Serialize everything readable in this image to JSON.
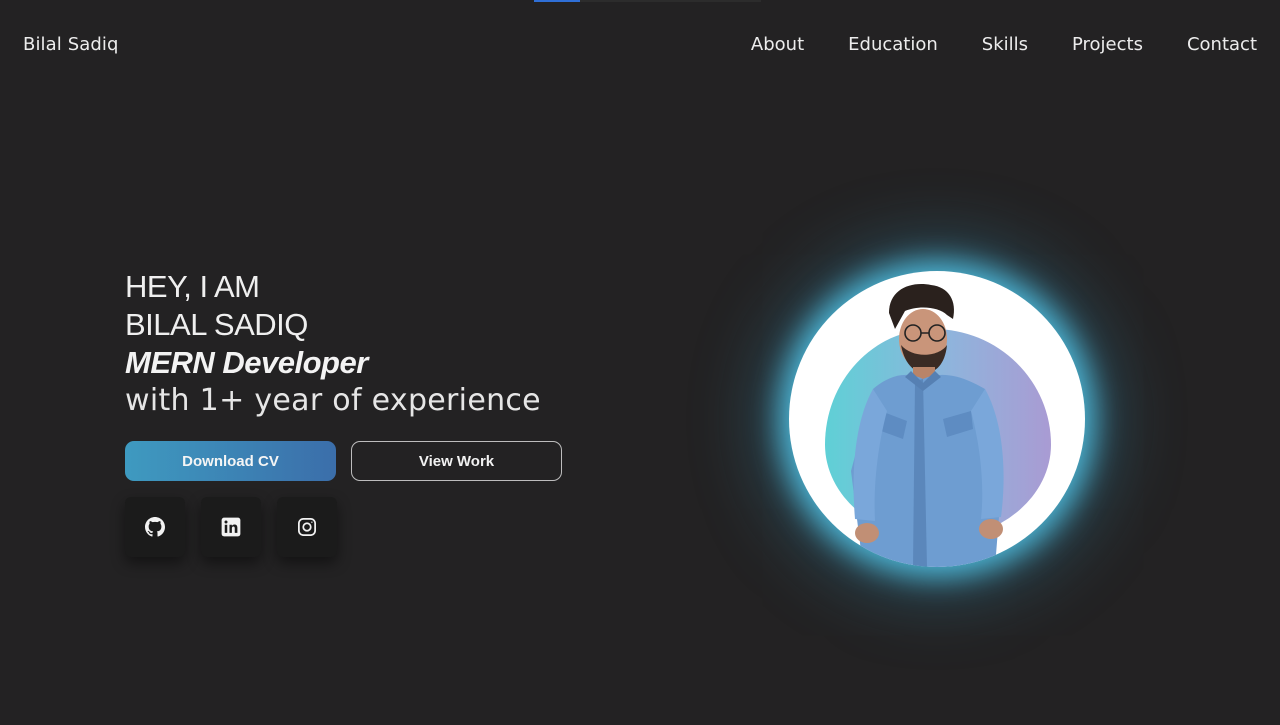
{
  "header": {
    "brand": "Bilal Sadiq",
    "nav": [
      {
        "label": "About"
      },
      {
        "label": "Education"
      },
      {
        "label": "Skills"
      },
      {
        "label": "Projects"
      },
      {
        "label": "Contact"
      }
    ]
  },
  "hero": {
    "line1": "HEY, I AM",
    "line2": "BILAL SADIQ",
    "role": "MERN Developer",
    "experience": "with 1+ year of experience",
    "primary_button": "Download CV",
    "secondary_button": "View Work"
  },
  "social": [
    {
      "icon": "github-icon"
    },
    {
      "icon": "linkedin-icon"
    },
    {
      "icon": "instagram-icon"
    }
  ],
  "avatar": {
    "glow_color": "#52c8eb",
    "blob_colors": [
      "#5fd0d6",
      "#a99bd3"
    ]
  },
  "colors": {
    "background": "#232223",
    "accent": "#3b6eaa",
    "scroll_fill": "#2f6fd6"
  },
  "scroll_progress": 0.2
}
